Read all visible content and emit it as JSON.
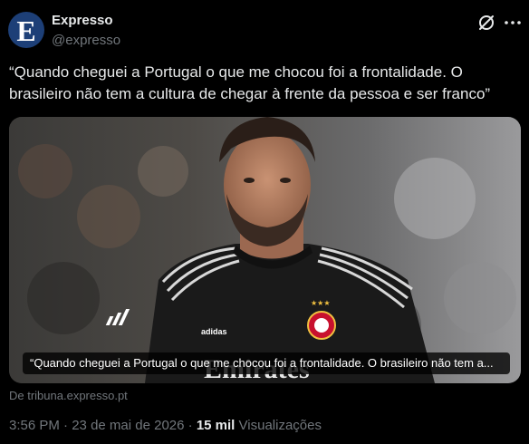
{
  "author": {
    "avatar_letter": "E",
    "display_name": "Expresso",
    "handle": "@expresso"
  },
  "tweet": {
    "text": "“Quando cheguei a Portugal o que me chocou foi a frontalidade. O brasileiro não tem a cultura de chegar à frente da pessoa e ser franco”"
  },
  "media": {
    "caption": "“Quando cheguei a Portugal o que me chocou foi a frontalidade. O brasileiro não tem a...",
    "source": "De tribuna.expresso.pt",
    "shirt_sponsor": "Emirates",
    "kit_brand": "adidas"
  },
  "meta": {
    "time": "3:56 PM",
    "separator": "·",
    "date": "23 de mai de 2026",
    "views_count": "15 mil",
    "views_label": "Visualizações"
  },
  "icons": {
    "grok": "grok-icon",
    "more": "more-icon"
  },
  "colors": {
    "background": "#000000",
    "text_primary": "#e7e9ea",
    "text_secondary": "#71767b",
    "avatar_bg": "#1d3f77"
  }
}
